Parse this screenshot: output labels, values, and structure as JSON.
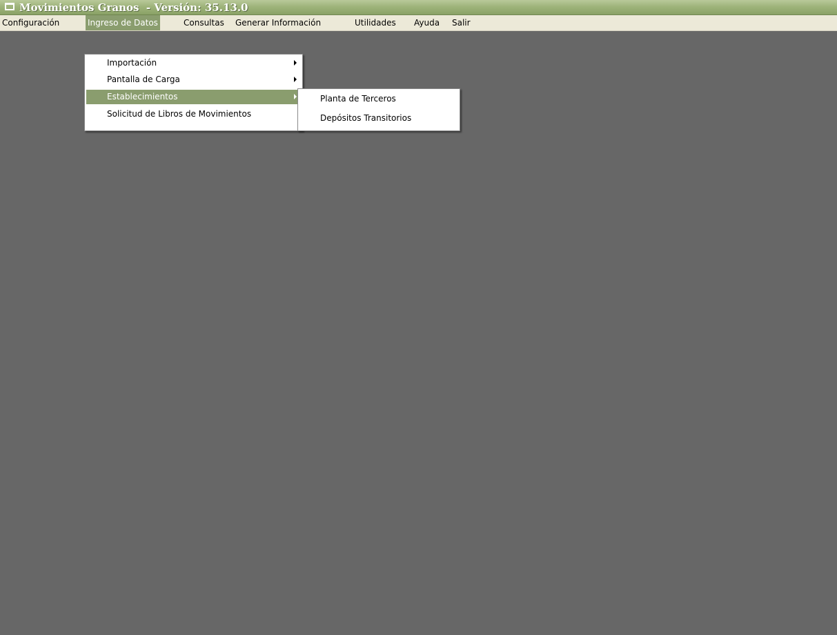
{
  "window": {
    "title": "Movimientos Granos  - Versión: 35.13.0"
  },
  "menubar": [
    {
      "label": "Configuración",
      "name": "menu-configuracion"
    },
    {
      "label": "Ingreso de Datos",
      "name": "menu-ingreso-de-datos",
      "active": true
    },
    {
      "label": "Consultas",
      "name": "menu-consultas"
    },
    {
      "label": "Generar Información",
      "name": "menu-generar-informacion"
    },
    {
      "label": "Utilidades",
      "name": "menu-utilidades"
    },
    {
      "label": "Ayuda",
      "name": "menu-ayuda"
    },
    {
      "label": "Salir",
      "name": "menu-salir"
    }
  ],
  "dropdown": {
    "items": [
      {
        "label": "Importación",
        "has_submenu": true
      },
      {
        "label": "Pantalla de Carga",
        "has_submenu": true
      },
      {
        "label": "Establecimientos",
        "has_submenu": true,
        "highlighted": true
      },
      {
        "label": "Solicitud de Libros de Movimientos",
        "has_submenu": false
      }
    ]
  },
  "submenu": {
    "items": [
      {
        "label": "Planta de Terceros"
      },
      {
        "label": "Depósitos Transitorios"
      }
    ]
  },
  "colors": {
    "desktop": "#676767",
    "highlight": "#8a9d6e",
    "menubar": "#ece9d8"
  },
  "icons": {
    "window": "window-icon",
    "submenu_arrow": "chevron-right-icon"
  }
}
